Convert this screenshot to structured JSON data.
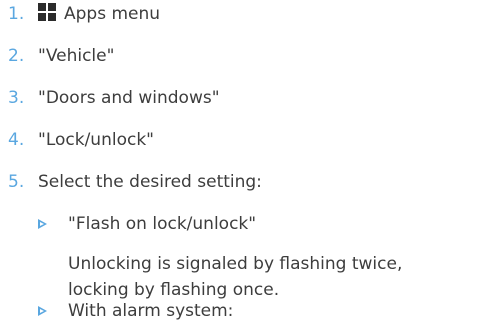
{
  "steps": [
    {
      "number": "1.",
      "label": "Apps menu",
      "icon": "apps-grid-icon"
    },
    {
      "number": "2.",
      "label": "\"Vehicle\""
    },
    {
      "number": "3.",
      "label": "\"Doors and windows\""
    },
    {
      "number": "4.",
      "label": "\"Lock/unlock\""
    },
    {
      "number": "5.",
      "label": "Select the desired setting:"
    }
  ],
  "options": [
    {
      "label": "\"Flash on lock/unlock\"",
      "description_line1": "Unlocking is signaled by flashing twice,",
      "description_line2": "locking by flashing once."
    },
    {
      "label": "With alarm system:"
    }
  ],
  "colors": {
    "accent": "#5aa7e0",
    "text": "#3d3d3d",
    "icon": "#2b2b2b"
  }
}
